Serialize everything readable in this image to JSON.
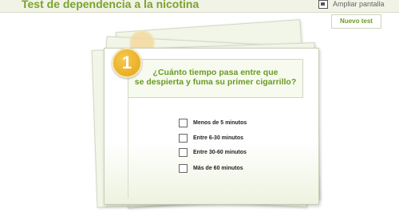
{
  "header": {
    "title": "Test de dependencia a la nicotina",
    "ampliar_label": "Ampliar pantalla"
  },
  "nuevo_test_label": "Nuevo test",
  "question": {
    "number": "1",
    "line1": "¿Cuánto tiempo pasa entre que",
    "line2": "se despierta y fuma su primer cigarrillo?"
  },
  "options": [
    "Menos de 5 minutos",
    "Entre 6-30 minutos",
    "Entre 30-60 minutos",
    "Más de 60 minutos"
  ],
  "colors": {
    "accent": "#7ba22e",
    "badge": "#f0b62a",
    "header_bg": "#f1f3e6"
  },
  "icons": {
    "ampliar": "fullscreen-icon"
  }
}
